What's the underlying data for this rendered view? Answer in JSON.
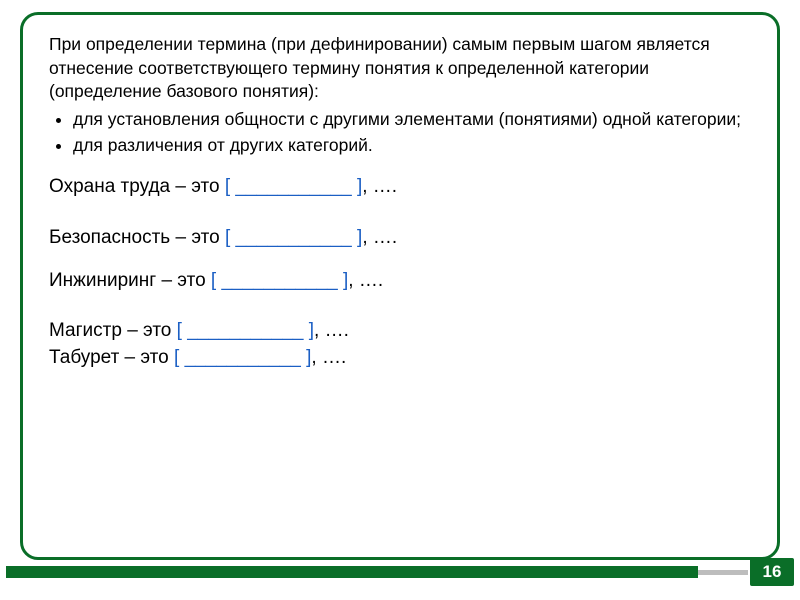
{
  "intro": "При определении термина (при дефинировании) самым первым шагом является отнесение соответствующего термину понятия к определенной категории (определение базового понятия):",
  "bullets": [
    "для установления общности с другими элементами (понятиями) одной категории;",
    "для различения от других категорий."
  ],
  "bracket_open": "[",
  "bracket_close": "]",
  "blank": "___________",
  "terms": [
    {
      "label": "Охрана труда – это ",
      "tail": ", …."
    },
    {
      "label": "Безопасность – это ",
      "tail": ", …."
    },
    {
      "label": "Инжиниринг – это ",
      "tail": ", …."
    },
    {
      "label": "Магистр – это ",
      "tail": ", …."
    },
    {
      "label": "Табурет – это ",
      "tail": ", …."
    }
  ],
  "page_number": "16",
  "colors": {
    "accent_green": "#0a6e28",
    "bracket_blue": "#1b5fc4",
    "bar_grey": "#bdbdbd"
  }
}
